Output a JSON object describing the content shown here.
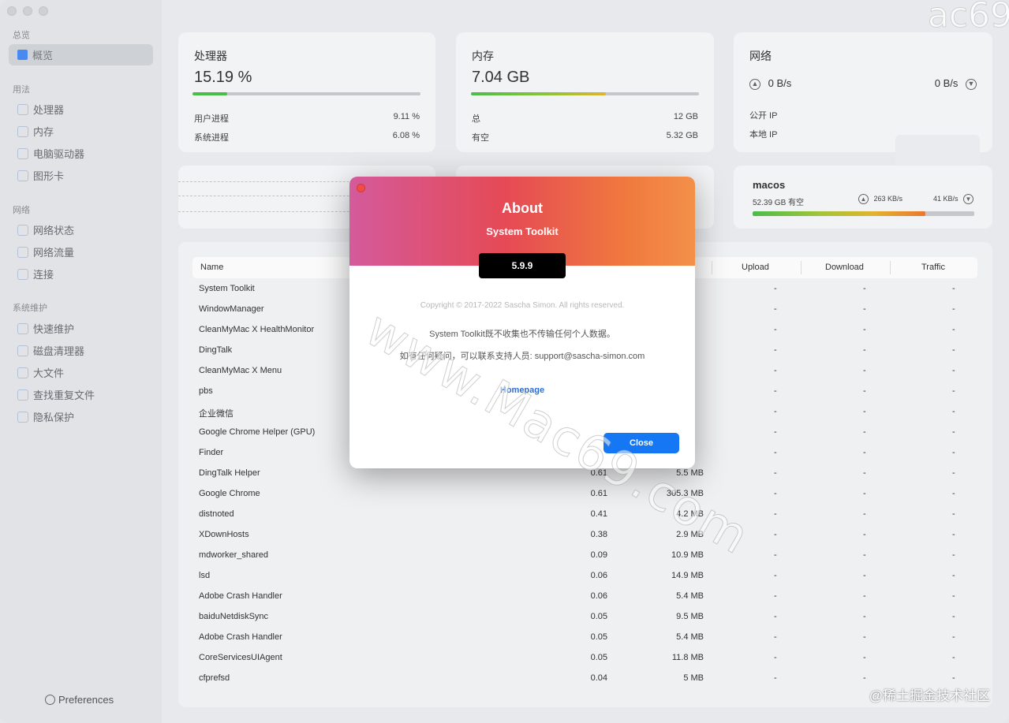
{
  "sidebar": {
    "sections": [
      {
        "title": "总览",
        "items": [
          {
            "label": "概览",
            "icon": "grid-icon",
            "active": true
          }
        ]
      },
      {
        "title": "用法",
        "items": [
          {
            "label": "处理器",
            "icon": "cpu-icon"
          },
          {
            "label": "内存",
            "icon": "memory-icon"
          },
          {
            "label": "电脑驱动器",
            "icon": "drive-icon"
          },
          {
            "label": "图形卡",
            "icon": "gpu-icon"
          }
        ]
      },
      {
        "title": "网络",
        "items": [
          {
            "label": "网络状态",
            "icon": "globe-icon"
          },
          {
            "label": "网络流量",
            "icon": "cloud-icon"
          },
          {
            "label": "连接",
            "icon": "monitor-icon"
          }
        ]
      },
      {
        "title": "系统维护",
        "items": [
          {
            "label": "快速维护",
            "icon": "lightning-icon"
          },
          {
            "label": "磁盘清理器",
            "icon": "broom-icon"
          },
          {
            "label": "大文件",
            "icon": "file-icon"
          },
          {
            "label": "查找重复文件",
            "icon": "duplicate-icon"
          },
          {
            "label": "隐私保护",
            "icon": "shield-icon"
          }
        ]
      }
    ],
    "preferences": "Preferences"
  },
  "cpu": {
    "title": "处理器",
    "value": "15.19 %",
    "progress": 0.1519,
    "user_label": "用户进程",
    "user_value": "9.11 %",
    "sys_label": "系统进程",
    "sys_value": "6.08 %"
  },
  "memory": {
    "title": "内存",
    "value": "7.04 GB",
    "progress": 0.59,
    "total_label": "总",
    "total_value": "12 GB",
    "free_label": "有空",
    "free_value": "5.32 GB"
  },
  "network": {
    "title": "网络",
    "up": "0 B/s",
    "down": "0 B/s",
    "public_ip_label": "公开 IP",
    "local_ip_label": "本地 IP"
  },
  "disk": {
    "name": "macos",
    "free": "52.39 GB 有空",
    "read": "263 KB/s",
    "write": "41 KB/s",
    "progress": 0.78
  },
  "table": {
    "headers": [
      "Name",
      "Upload",
      "Download",
      "Traffic"
    ],
    "rows": [
      {
        "name": "System Toolkit",
        "cpu": "",
        "mem": ""
      },
      {
        "name": "WindowManager",
        "cpu": "",
        "mem": ""
      },
      {
        "name": "CleanMyMac X HealthMonitor",
        "cpu": "",
        "mem": ""
      },
      {
        "name": "DingTalk",
        "cpu": "",
        "mem": ""
      },
      {
        "name": "CleanMyMac X Menu",
        "cpu": "",
        "mem": ""
      },
      {
        "name": "pbs",
        "cpu": "",
        "mem": ""
      },
      {
        "name": "企业微信",
        "cpu": "",
        "mem": ""
      },
      {
        "name": "Google Chrome Helper (GPU)",
        "cpu": "",
        "mem": ""
      },
      {
        "name": "Finder",
        "cpu": "",
        "mem": ""
      },
      {
        "name": "DingTalk Helper",
        "cpu": "0.61",
        "mem": "5.5 MB"
      },
      {
        "name": "Google Chrome",
        "cpu": "0.61",
        "mem": "305.3 MB"
      },
      {
        "name": "distnoted",
        "cpu": "0.41",
        "mem": "4.2 MB"
      },
      {
        "name": "XDownHosts",
        "cpu": "0.38",
        "mem": "2.9 MB"
      },
      {
        "name": "mdworker_shared",
        "cpu": "0.09",
        "mem": "10.9 MB"
      },
      {
        "name": "lsd",
        "cpu": "0.06",
        "mem": "14.9 MB"
      },
      {
        "name": "Adobe Crash Handler",
        "cpu": "0.06",
        "mem": "5.4 MB"
      },
      {
        "name": "baiduNetdiskSync",
        "cpu": "0.05",
        "mem": "9.5 MB"
      },
      {
        "name": "Adobe Crash Handler",
        "cpu": "0.05",
        "mem": "5.4 MB"
      },
      {
        "name": "CoreServicesUIAgent",
        "cpu": "0.05",
        "mem": "11.8 MB"
      },
      {
        "name": "cfprefsd",
        "cpu": "0.04",
        "mem": "5 MB"
      }
    ],
    "dash": "-"
  },
  "about": {
    "title": "About",
    "app": "System Toolkit",
    "version": "5.9.9",
    "copyright": "Copyright © 2017-2022 Sascha Simon. All rights reserved.",
    "privacy": "System Toolkit既不收集也不传输任何个人数据。",
    "contact": "如有任何疑问，可以联系支持人员: support@sascha-simon.com",
    "homepage": "Homepage",
    "close": "Close"
  },
  "watermarks": {
    "main": "www.Mac69.com",
    "corner": "@稀土掘金技术社区",
    "top": "ac69"
  },
  "colors": {
    "accent": "#1677f5",
    "cpu_bar": "#4cc04c",
    "grad_start": "#d45a9b",
    "grad_end": "#f3904a"
  }
}
